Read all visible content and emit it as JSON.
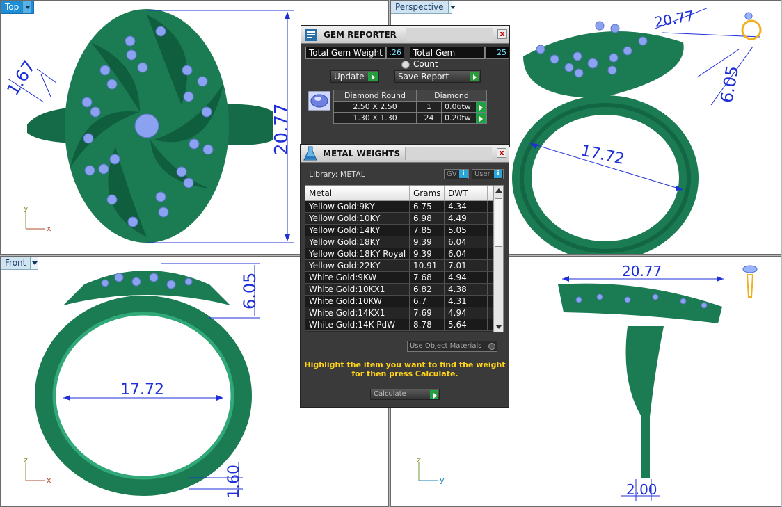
{
  "viewports": {
    "top": {
      "title": "Top",
      "dims": {
        "width_label": "1.67",
        "height_label": "20.77"
      },
      "axis": {
        "v": "y",
        "h": "x"
      }
    },
    "perspective": {
      "title": "Perspective",
      "dims": {
        "top_label": "20.77",
        "side_label": "6.05",
        "ring_label": "17.72"
      }
    },
    "front": {
      "title": "Front",
      "dims": {
        "height_label": "6.05",
        "ring_label": "17.72",
        "band_label": "1.60"
      },
      "axis": {
        "v": "z",
        "h": "x"
      }
    },
    "right": {
      "dims": {
        "top_label": "20.77",
        "shank_label": "2.00"
      },
      "axis": {
        "v": "z",
        "h": "y"
      }
    }
  },
  "gem_reporter": {
    "title": "GEM REPORTER",
    "close": "x",
    "total_weight_label": "Total Gem Weight",
    "total_weight_value": ".26",
    "total_count_label": "Total Gem Count",
    "total_count_value": "25",
    "update_label": "Update",
    "save_label": "Save Report",
    "table": {
      "headers": [
        "Diamond Round",
        "Diamond"
      ],
      "rows": [
        {
          "size": "2.50 X 2.50",
          "count": "1",
          "weight": "0.06tw"
        },
        {
          "size": "1.30 X 1.30",
          "count": "24",
          "weight": "0.20tw"
        }
      ]
    }
  },
  "metal_weights": {
    "title": "METAL WEIGHTS",
    "close": "x",
    "library_label": "Library: METAL",
    "gv_label": "GV",
    "user_label": "User",
    "info_glyph": "i",
    "headers": [
      "Metal",
      "Grams",
      "DWT"
    ],
    "rows": [
      {
        "metal": "Yellow Gold:9KY",
        "grams": "6.75",
        "dwt": "4.34"
      },
      {
        "metal": "Yellow Gold:10KY",
        "grams": "6.98",
        "dwt": "4.49"
      },
      {
        "metal": "Yellow Gold:14KY",
        "grams": "7.85",
        "dwt": "5.05"
      },
      {
        "metal": "Yellow Gold:18KY",
        "grams": "9.39",
        "dwt": "6.04"
      },
      {
        "metal": "Yellow Gold:18KY Royal",
        "grams": "9.39",
        "dwt": "6.04"
      },
      {
        "metal": "Yellow Gold:22KY",
        "grams": "10.91",
        "dwt": "7.01"
      },
      {
        "metal": "White Gold:9KW",
        "grams": "7.68",
        "dwt": "4.94"
      },
      {
        "metal": "White Gold:10KX1",
        "grams": "6.82",
        "dwt": "4.38"
      },
      {
        "metal": "White Gold:10KW",
        "grams": "6.7",
        "dwt": "4.31"
      },
      {
        "metal": "White Gold:14KX1",
        "grams": "7.69",
        "dwt": "4.94"
      },
      {
        "metal": "White Gold:14K PdW",
        "grams": "8.78",
        "dwt": "5.64"
      }
    ],
    "use_object_materials": "Use Object Materials",
    "hint_line1": "Highlight the item you want to find the weight",
    "hint_line2": "for then press Calculate.",
    "calculate_label": "Calculate"
  },
  "colors": {
    "ring_green": "#1e7a55",
    "gem_blue": "#8aa2f0",
    "dim_blue": "#1e2fd8",
    "viewport_active": "#1c8ed8"
  }
}
